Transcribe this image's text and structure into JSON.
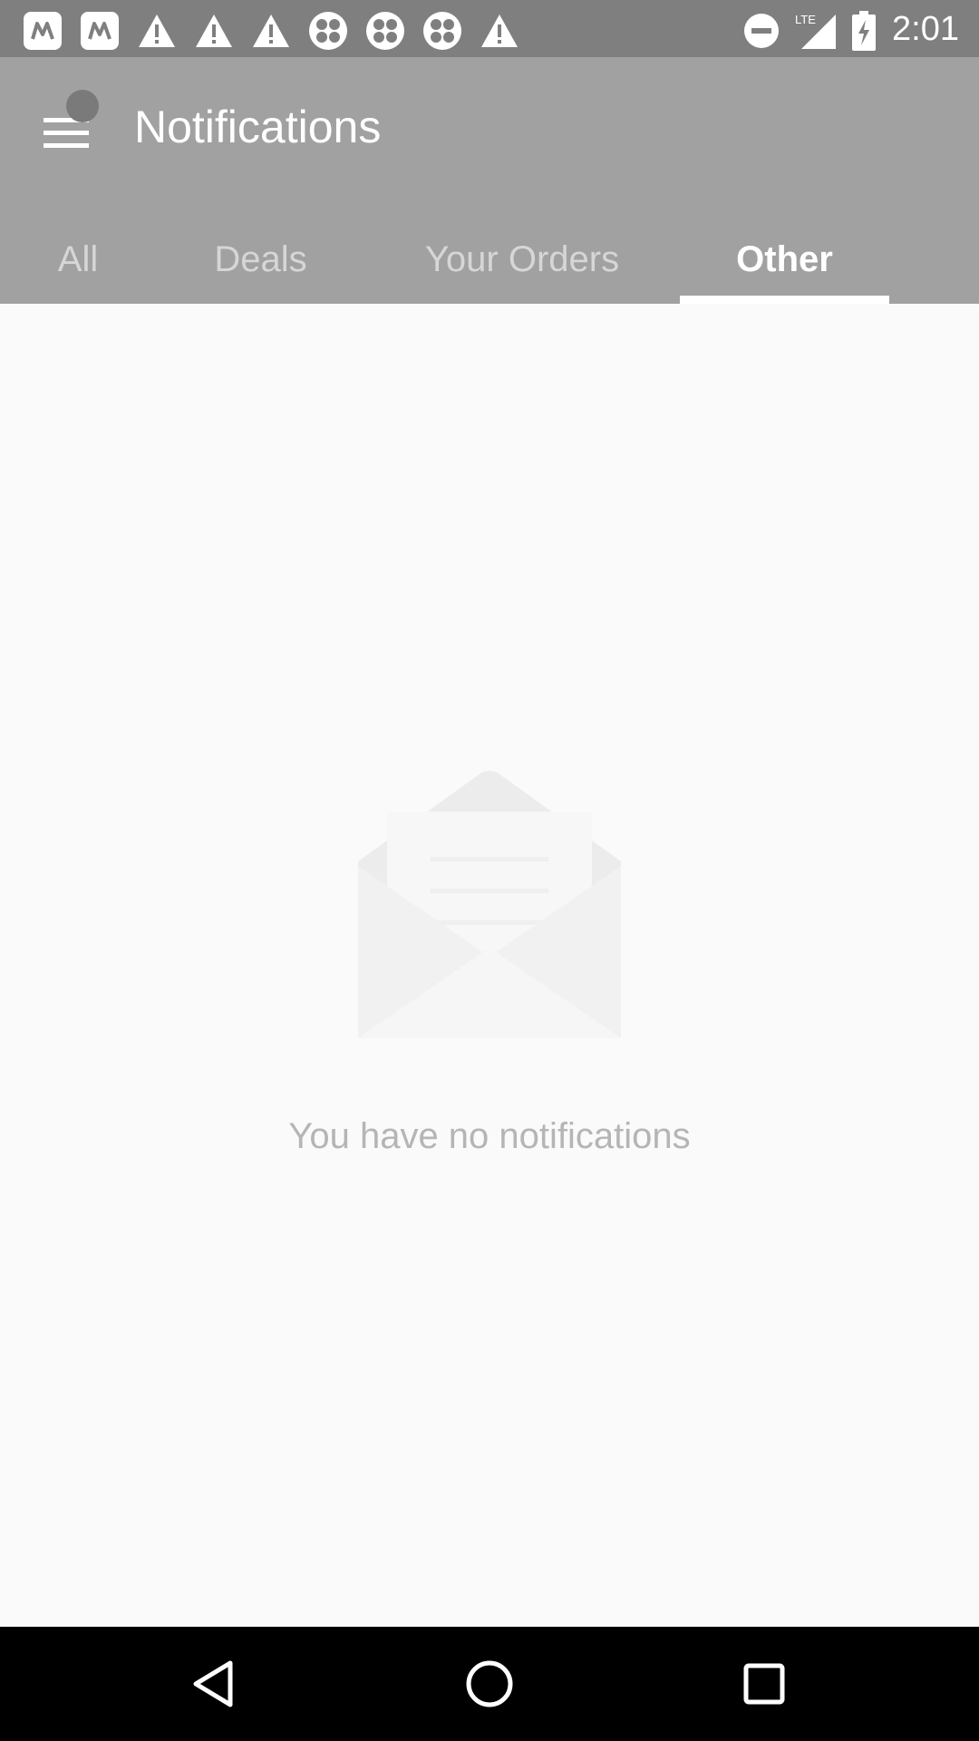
{
  "status_bar": {
    "time": "2:01",
    "left_icons": [
      "app-icon",
      "app-icon",
      "warning-icon",
      "warning-icon",
      "warning-icon",
      "clover-icon",
      "clover-icon",
      "clover-icon",
      "warning-icon"
    ],
    "network_label": "LTE"
  },
  "app_bar": {
    "title": "Notifications"
  },
  "tabs": [
    {
      "label": "All"
    },
    {
      "label": "Deals"
    },
    {
      "label": "Your Orders"
    },
    {
      "label": "Other"
    }
  ],
  "active_tab": "Other",
  "empty_state": {
    "message": "You have no notifications",
    "icon": "open-envelope-icon"
  },
  "nav_bar": {
    "icons": [
      "back-icon",
      "home-icon",
      "recents-icon"
    ]
  },
  "colors": {
    "status_bar_bg": "#7f7f7f",
    "app_bar_bg": "#a1a1a1",
    "content_bg": "#fafafa",
    "nav_bar_bg": "#000000"
  }
}
